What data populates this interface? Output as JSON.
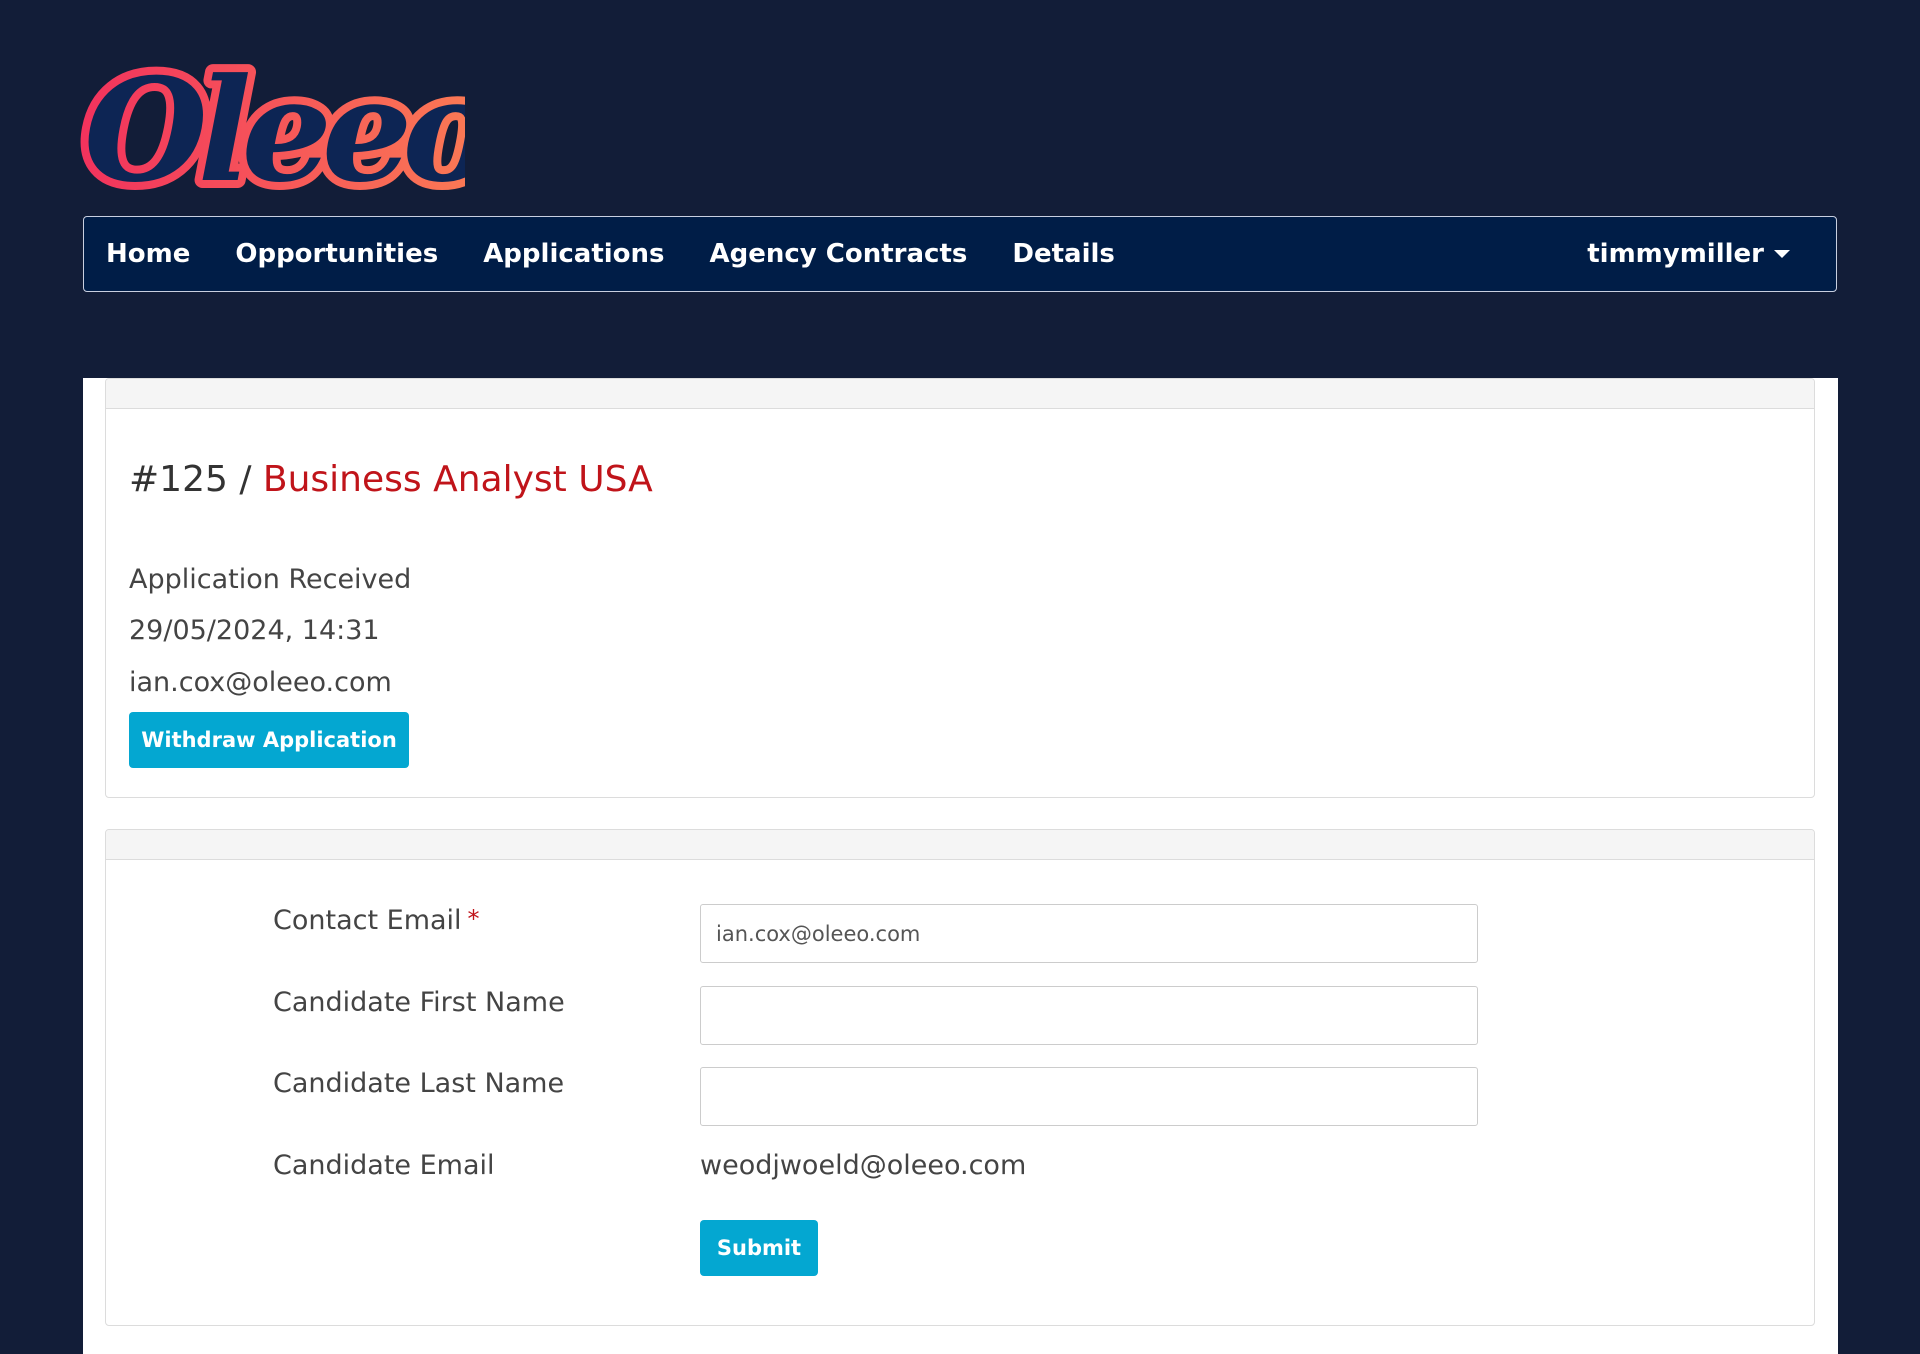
{
  "brand": {
    "logo_text": "Oleeo",
    "gradient_start": "#f2335d",
    "gradient_end": "#fb7d54",
    "letter_color": "#0d2554"
  },
  "nav": {
    "items": [
      {
        "label": "Home"
      },
      {
        "label": "Opportunities"
      },
      {
        "label": "Applications"
      },
      {
        "label": "Agency Contracts"
      },
      {
        "label": "Details"
      }
    ],
    "user": "timmymiller"
  },
  "application": {
    "id": "#125",
    "separator": " / ",
    "job_title": "Business Analyst USA",
    "status": "Application Received",
    "date": "29/05/2024, 14:31",
    "email": "ian.cox@oleeo.com",
    "withdraw_label": "Withdraw Application"
  },
  "form": {
    "contact_email_label": "Contact Email",
    "required_mark": "*",
    "contact_email_value": "ian.cox@oleeo.com",
    "first_name_label": "Candidate First Name",
    "first_name_value": "",
    "last_name_label": "Candidate Last Name",
    "last_name_value": "",
    "candidate_email_label": "Candidate Email",
    "candidate_email_value": "weodjwoeld@oleeo.com",
    "submit_label": "Submit"
  },
  "colors": {
    "page_bg": "#121d38",
    "navbar_bg": "#001d47",
    "accent_button": "#04a7d1",
    "title_red": "#c0141a"
  }
}
